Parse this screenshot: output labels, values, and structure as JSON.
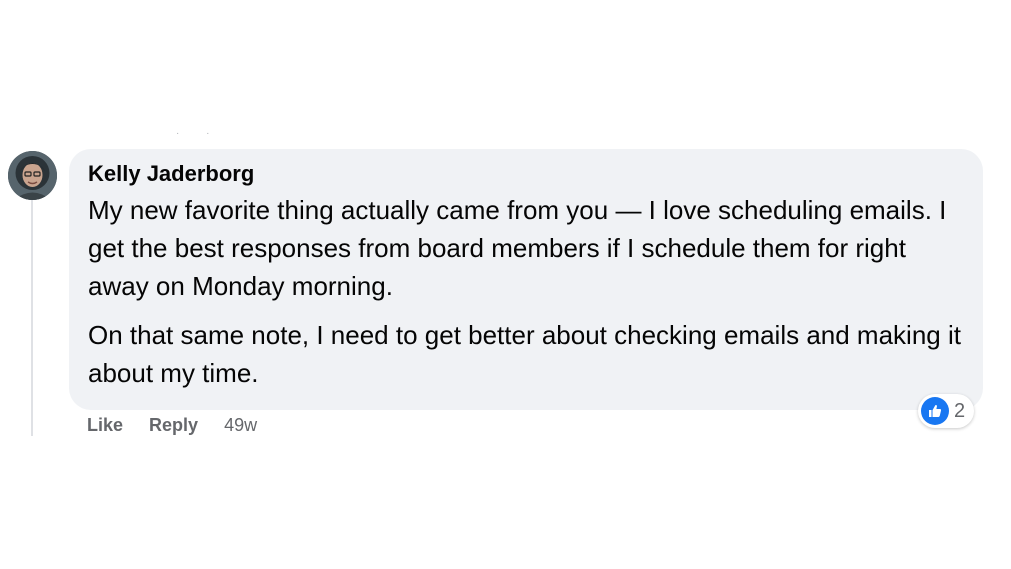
{
  "comment": {
    "author": "Kelly Jaderborg",
    "paragraphs": [
      "My new favorite thing actually came from you — I love scheduling emails. I get the best responses from board members if I schedule them for right away on Monday morning.",
      "On that same note, I need to get better about checking emails and making it about my time."
    ],
    "reactions": {
      "icon": "thumbs-up-icon",
      "count": "2",
      "color": "#1877f2"
    },
    "actions": {
      "like_label": "Like",
      "reply_label": "Reply",
      "timestamp": "49w"
    }
  },
  "colors": {
    "bubble_bg": "#f0f2f5",
    "meta_text": "#65676b",
    "like_blue": "#1877f2"
  }
}
